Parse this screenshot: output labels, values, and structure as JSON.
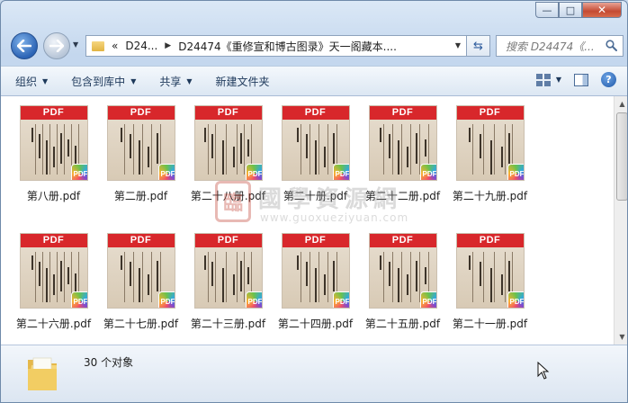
{
  "window": {
    "caption": {
      "minimize": "—",
      "maximize": "□",
      "close": "✕"
    }
  },
  "nav": {
    "back_icon": "arrow-left-icon",
    "forward_icon": "arrow-right-icon",
    "breadcrumb": [
      "«",
      "D24...",
      "D24474《重修宣和博古图录》天一阁藏本...."
    ],
    "search_placeholder": "搜索 D24474《...",
    "refresh_icon": "refresh-icon"
  },
  "toolbar": {
    "organize": "组织",
    "include_in_library": "包含到库中",
    "share": "共享",
    "new_folder": "新建文件夹"
  },
  "files": [
    {
      "name": "第八册.pdf",
      "badge": "PDF",
      "band": "PDF"
    },
    {
      "name": "第二册.pdf",
      "badge": "PDF",
      "band": "PDF"
    },
    {
      "name": "第二十八册.pdf",
      "badge": "PDF",
      "band": "PDF"
    },
    {
      "name": "第二十册.pdf",
      "badge": "PDF",
      "band": "PDF"
    },
    {
      "name": "第二十二册.pdf",
      "badge": "PDF",
      "band": "PDF"
    },
    {
      "name": "第二十九册.pdf",
      "badge": "PDF",
      "band": "PDF"
    },
    {
      "name": "第二十六册.pdf",
      "badge": "PDF",
      "band": "PDF"
    },
    {
      "name": "第二十七册.pdf",
      "badge": "PDF",
      "band": "PDF"
    },
    {
      "name": "第二十三册.pdf",
      "badge": "PDF",
      "band": "PDF"
    },
    {
      "name": "第二十四册.pdf",
      "badge": "PDF",
      "band": "PDF"
    },
    {
      "name": "第二十五册.pdf",
      "badge": "PDF",
      "band": "PDF"
    },
    {
      "name": "第二十一册.pdf",
      "badge": "PDF",
      "band": "PDF"
    }
  ],
  "watermark": {
    "seal": "臨",
    "title": "國學資源網",
    "url": "www.guoxueziyuan.com"
  },
  "status": {
    "count_text": "30 个对象"
  },
  "colors": {
    "pdf_band": "#d8272b",
    "window_frame": "#c4d7ee",
    "toolbar_text": "#1e395b"
  }
}
